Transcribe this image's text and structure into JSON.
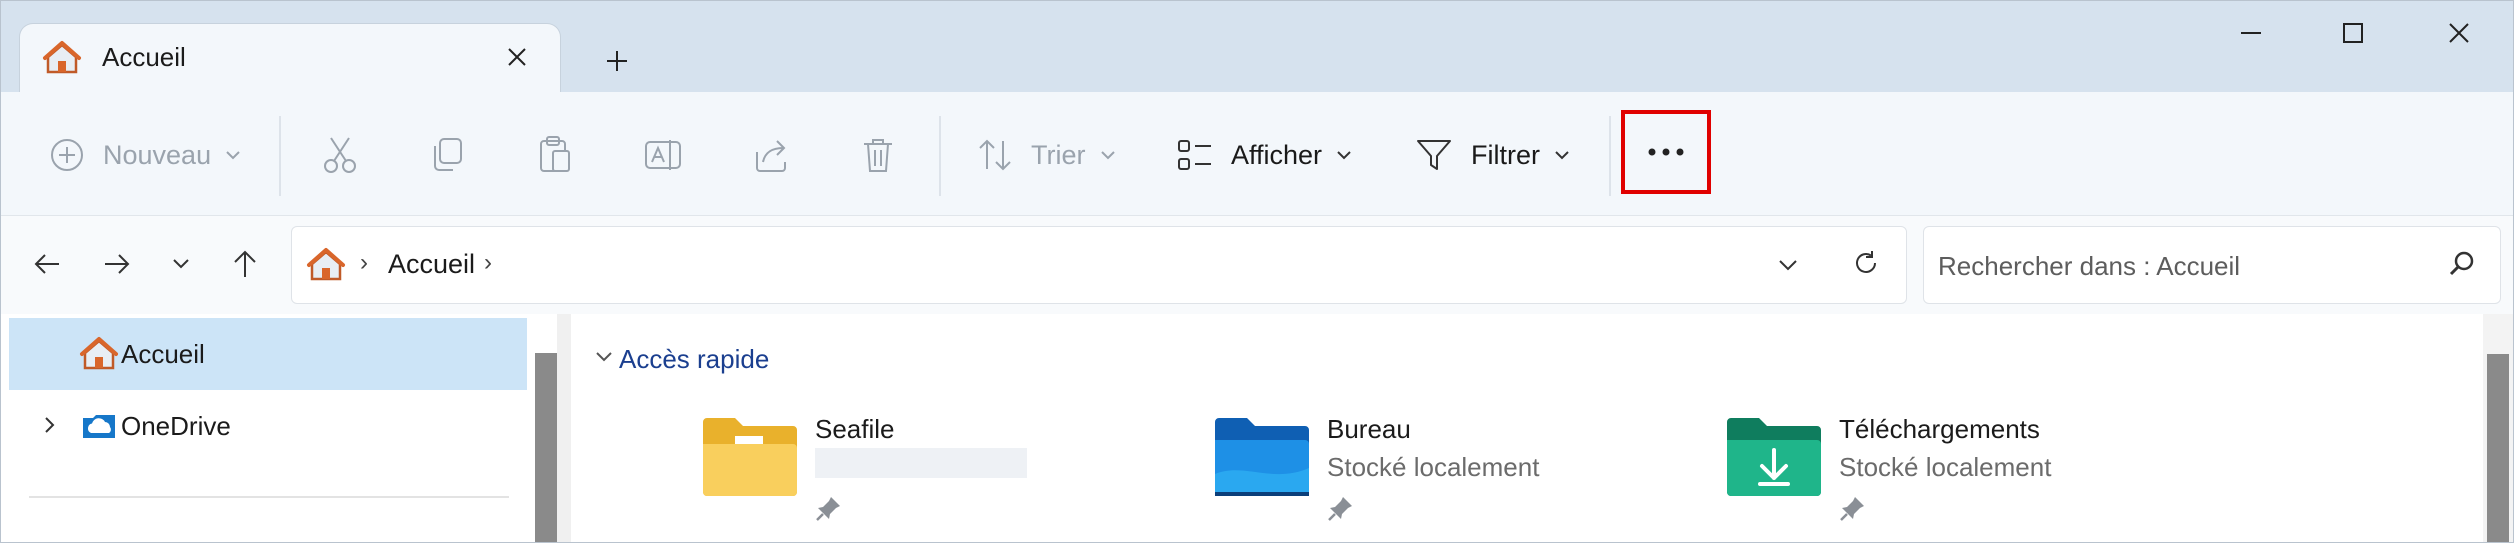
{
  "window": {
    "tab_title": "Accueil"
  },
  "toolbar": {
    "new_label": "Nouveau",
    "sort_label": "Trier",
    "view_label": "Afficher",
    "filter_label": "Filtrer",
    "more_label": "•••"
  },
  "address": {
    "breadcrumb": [
      "Accueil"
    ],
    "search_placeholder": "Rechercher dans : Accueil"
  },
  "nav": {
    "items": [
      {
        "label": "Accueil",
        "icon": "home-icon",
        "selected": true
      },
      {
        "label": "OneDrive",
        "icon": "onedrive-icon",
        "selected": false
      }
    ]
  },
  "content": {
    "section_title": "Accès rapide",
    "tiles": [
      {
        "name": "Seafile",
        "subtitle": "",
        "icon": "folder-yellow-icon"
      },
      {
        "name": "Bureau",
        "subtitle": "Stocké localement",
        "icon": "folder-desktop-icon"
      },
      {
        "name": "Téléchargements",
        "subtitle": "Stocké localement",
        "icon": "folder-downloads-icon"
      }
    ]
  },
  "colors": {
    "accent_highlight": "#e00000",
    "selection": "#cce4f7",
    "section_title": "#1b3f8f"
  }
}
